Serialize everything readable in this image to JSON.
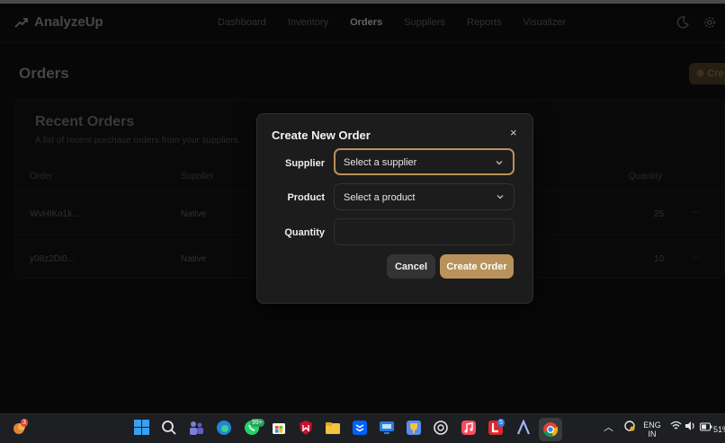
{
  "app": {
    "brand": "AnalyzeUp",
    "nav": [
      {
        "label": "Dashboard",
        "active": false
      },
      {
        "label": "Inventory",
        "active": false
      },
      {
        "label": "Orders",
        "active": true
      },
      {
        "label": "Suppliers",
        "active": false
      },
      {
        "label": "Reports",
        "active": false
      },
      {
        "label": "Visualizer",
        "active": false
      }
    ],
    "page_title": "Orders",
    "create_button_label": "Cre"
  },
  "recent_orders": {
    "title": "Recent Orders",
    "subtitle": "A list of recent purchase orders from your suppliers.",
    "columns": {
      "order": "Order",
      "supplier": "Supplier",
      "quantity": "Quantity"
    },
    "rows": [
      {
        "order": "WvHIKo1k...",
        "supplier": "Native",
        "quantity": "25",
        "menu": "···"
      },
      {
        "order": "y08z2Di0...",
        "supplier": "Native",
        "quantity": "10",
        "menu": "···"
      }
    ]
  },
  "modal": {
    "title": "Create New Order",
    "close": "×",
    "supplier_label": "Supplier",
    "supplier_placeholder": "Select a supplier",
    "product_label": "Product",
    "product_placeholder": "Select a product",
    "quantity_label": "Quantity",
    "quantity_value": "",
    "cancel_label": "Cancel",
    "submit_label": "Create Order"
  },
  "taskbar": {
    "notification_badge": "3",
    "whatsapp_badge": "99+",
    "l_app_badge": "5",
    "language": "ENG",
    "region": "IN",
    "battery": "51%"
  },
  "colors": {
    "accent": "#b8925a",
    "background": "#0c0c0d",
    "modal_bg": "#1c1c1d"
  }
}
